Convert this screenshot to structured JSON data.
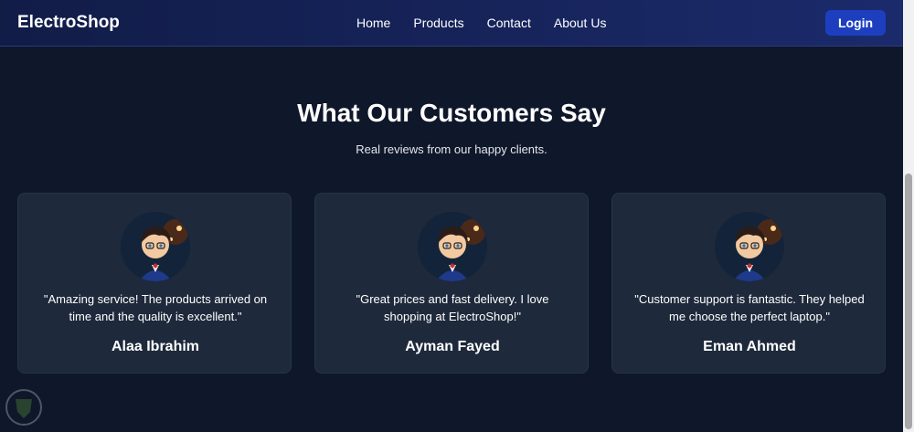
{
  "navbar": {
    "brand": "ElectroShop",
    "links": [
      {
        "label": "Home"
      },
      {
        "label": "Products"
      },
      {
        "label": "Contact"
      },
      {
        "label": "About Us"
      }
    ],
    "login_label": "Login"
  },
  "testimonials": {
    "title": "What Our Customers Say",
    "subtitle": "Real reviews from our happy clients.",
    "items": [
      {
        "quote": "\"Amazing service! The products arrived on time and the quality is excellent.\"",
        "name": "Alaa Ibrahim",
        "avatar_icon": "anime-boy-avatar"
      },
      {
        "quote": "\"Great prices and fast delivery. I love shopping at ElectroShop!\"",
        "name": "Ayman Fayed",
        "avatar_icon": "anime-boy-avatar"
      },
      {
        "quote": "\"Customer support is fantastic. They helped me choose the perfect laptop.\"",
        "name": "Eman Ahmed",
        "avatar_icon": "anime-boy-avatar"
      }
    ]
  },
  "colors": {
    "background": "#0f172a",
    "card": "#1e293b",
    "navbar": "#1b2a6b",
    "accent": "#1d3fbf"
  }
}
